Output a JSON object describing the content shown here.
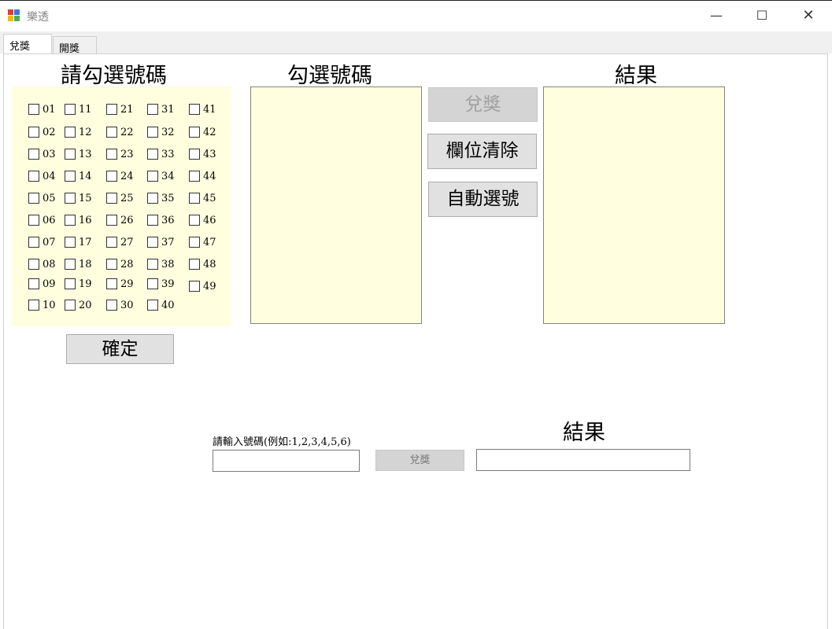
{
  "window": {
    "title": "樂透",
    "minimize_glyph": "—",
    "maximize_glyph": "☐",
    "close_glyph": "✕",
    "icon": "app-icon"
  },
  "tabs": [
    {
      "label": "兌獎",
      "selected": true
    },
    {
      "label": "開獎",
      "selected": false
    }
  ],
  "panel": {
    "heading": "請勾選號碼",
    "numbers": [
      "01",
      "02",
      "03",
      "04",
      "05",
      "06",
      "07",
      "08",
      "09",
      "10",
      "11",
      "12",
      "13",
      "14",
      "15",
      "16",
      "17",
      "18",
      "19",
      "20",
      "21",
      "22",
      "23",
      "24",
      "25",
      "26",
      "27",
      "28",
      "29",
      "30",
      "31",
      "32",
      "33",
      "34",
      "35",
      "36",
      "37",
      "38",
      "39",
      "40",
      "41",
      "42",
      "43",
      "44",
      "45",
      "46",
      "47",
      "48",
      "49"
    ],
    "confirm_label": "確定"
  },
  "checked_list": {
    "heading": "勾選號碼",
    "items": []
  },
  "result_list": {
    "heading": "結果",
    "items": []
  },
  "buttons": {
    "redeem": "兌獎",
    "clear": "欄位清除",
    "auto_pick": "自動選號"
  },
  "manual": {
    "label": "請輸入號碼(例如:1,2,3,4,5,6)",
    "input_value": "",
    "redeem_label": "兌獎",
    "result_heading": "結果",
    "result_value": ""
  },
  "colors": {
    "panel_bg": "#ffffe0",
    "button_bg": "#e1e1e1",
    "disabled_text": "#a0a0a0"
  }
}
